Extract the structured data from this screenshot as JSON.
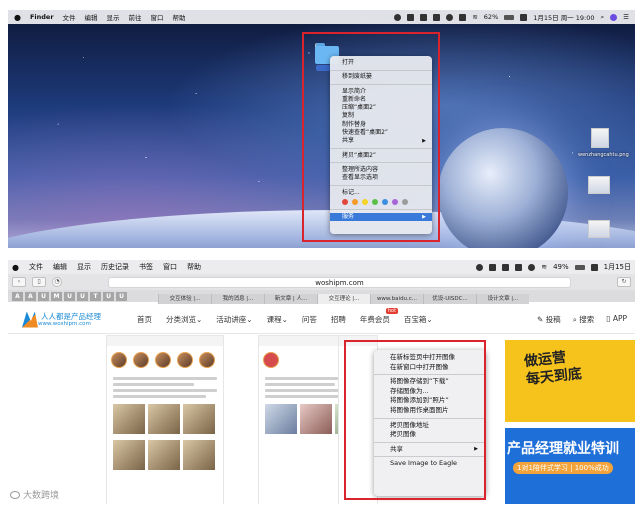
{
  "top": {
    "menubar": {
      "apple": "",
      "items": [
        "Finder",
        "文件",
        "编辑",
        "显示",
        "前往",
        "窗口",
        "帮助"
      ],
      "battery": "62%",
      "date": "1月15日 周一 19:00"
    },
    "context_menu": {
      "items": [
        {
          "label": "打开"
        },
        {
          "sep": true
        },
        {
          "label": "移到废纸篓"
        },
        {
          "sep": true
        },
        {
          "label": "显示简介"
        },
        {
          "label": "重新命名"
        },
        {
          "label": "压缩“桌面2”"
        },
        {
          "label": "复制"
        },
        {
          "label": "制作替身"
        },
        {
          "label": "快速查看“桌面2”"
        },
        {
          "label": "共享",
          "submenu": true
        },
        {
          "sep": true
        },
        {
          "label": "拷贝“桌面2”"
        },
        {
          "sep": true
        },
        {
          "label": "整理所选内容"
        },
        {
          "label": "查看显示选项"
        },
        {
          "sep": true
        },
        {
          "label": "标记..."
        },
        {
          "tags": [
            "#e2463b",
            "#f39a2b",
            "#f5d328",
            "#5bc04b",
            "#3c8ee0",
            "#a865d9",
            "#9b9b9b"
          ]
        },
        {
          "sep": true
        },
        {
          "label": "服务",
          "submenu": true,
          "highlight": true
        }
      ]
    },
    "desktop_labels": [
      "wenzhangcahtu.png"
    ]
  },
  "bottom": {
    "menubar": {
      "items": [
        "文件",
        "编辑",
        "显示",
        "历史记录",
        "书签",
        "窗口",
        "帮助"
      ],
      "battery": "49%",
      "date": "1月15日"
    },
    "url": "woshipm.com",
    "favbar_letters": [
      "A",
      "A",
      "U",
      "M",
      "U",
      "U",
      "T",
      "U",
      "U"
    ],
    "tabs": [
      "交互体验 |...",
      "我的消息 |...",
      "新文章 | 人...",
      "交互理论 |...",
      "www.baidu.c...",
      "优设-UISDC...",
      "设计文章 |..."
    ],
    "site": {
      "logo_title": "人人都是产品经理",
      "logo_sub": "www.woshipm.com",
      "nav": [
        "首页",
        "分类浏览⌄",
        "活动讲座⌄",
        "课程⌄",
        "问答",
        "招聘",
        "年费会员",
        "百宝箱⌄"
      ],
      "hot_badge": "hot",
      "tools": [
        "投稿",
        "搜索",
        "APP"
      ]
    },
    "context_menu": {
      "items": [
        {
          "label": "在新标签页中打开图像"
        },
        {
          "label": "在新窗口中打开图像"
        },
        {
          "sep": true
        },
        {
          "label": "将图像存储到“下载”"
        },
        {
          "label": "存储图像为..."
        },
        {
          "label": "将图像添加到“照片”"
        },
        {
          "label": "将图像用作桌面图片"
        },
        {
          "sep": true
        },
        {
          "label": "拷贝图像地址"
        },
        {
          "label": "拷贝图像"
        },
        {
          "sep": true
        },
        {
          "label": "共享",
          "submenu": true
        },
        {
          "sep": true
        },
        {
          "label": "Save Image to Eagle"
        }
      ]
    },
    "ads": {
      "ad1_text": "做运营\n每天到底",
      "ad2_title": "产品经理就业特训",
      "ad2_sub": "1对1陪伴式学习 | 100%成功"
    }
  },
  "watermark": "大数跨境"
}
